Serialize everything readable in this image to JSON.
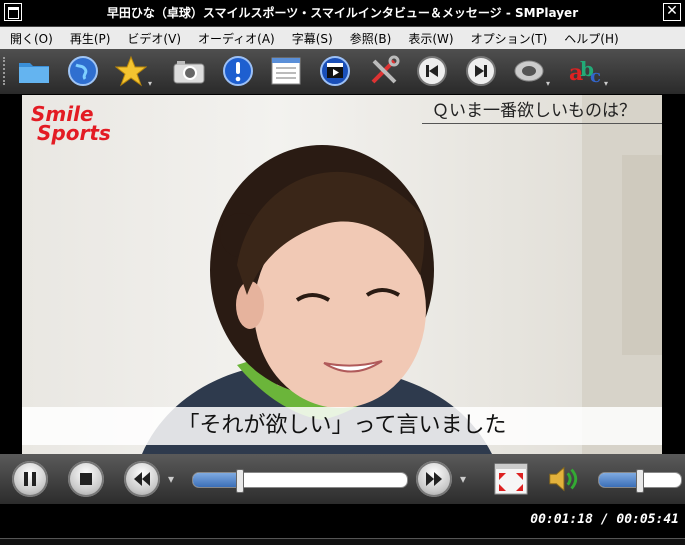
{
  "window": {
    "title": "早田ひな（卓球）スマイルスポーツ・スマイルインタビュー＆メッセージ - SMPlayer"
  },
  "menu": [
    {
      "label": "開く(O)"
    },
    {
      "label": "再生(P)"
    },
    {
      "label": "ビデオ(V)"
    },
    {
      "label": "オーディオ(A)"
    },
    {
      "label": "字幕(S)"
    },
    {
      "label": "参照(B)"
    },
    {
      "label": "表示(W)"
    },
    {
      "label": "オプション(T)"
    },
    {
      "label": "ヘルプ(H)"
    }
  ],
  "toolbar": {
    "icons": [
      "folder-icon",
      "globe-icon",
      "favorites-star-icon",
      "camera-icon",
      "info-icon",
      "playlist-icon",
      "video-clapper-icon",
      "tools-icon",
      "previous-track-icon",
      "next-track-icon",
      "audio-speaker-icon",
      "subtitles-abc-icon"
    ]
  },
  "video": {
    "logo": {
      "line1": "Smile",
      "line2": "Sports"
    },
    "question": "Ｑいま一番欲しいものは？",
    "caption": "「それが欲しい」って言いました"
  },
  "controls": {
    "progress_fraction": 0.22,
    "volume_fraction": 0.5,
    "accent": "#3c6fb8"
  },
  "status": {
    "time": "00:01:18 / 00:05:41"
  }
}
